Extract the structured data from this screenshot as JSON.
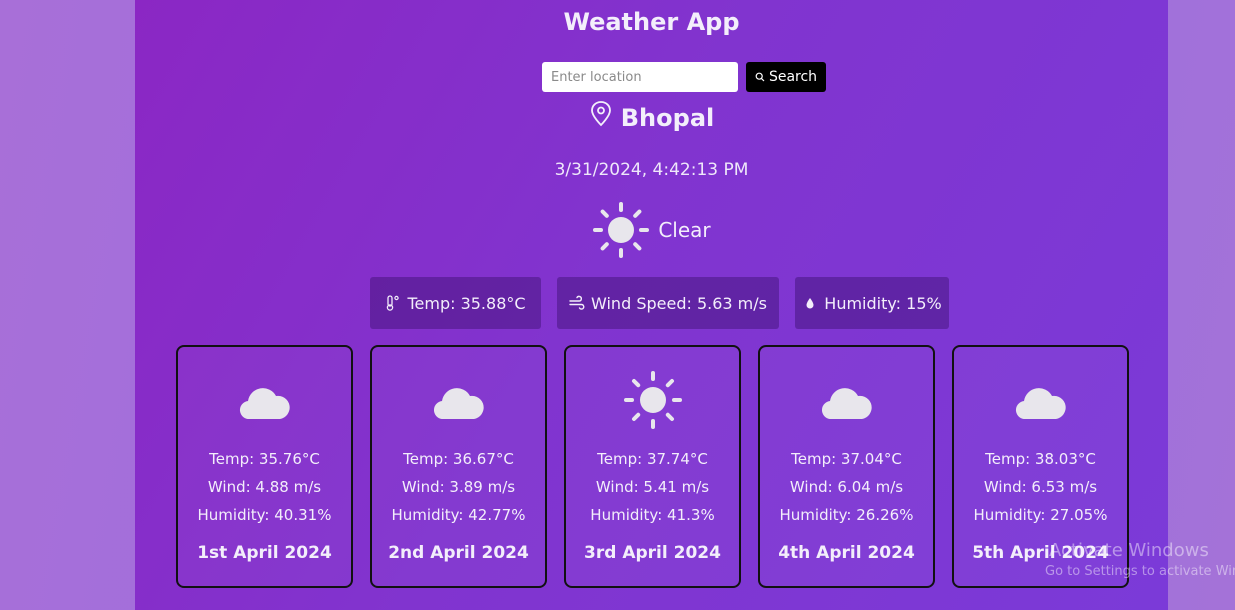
{
  "app": {
    "title": "Weather App"
  },
  "search": {
    "placeholder": "Enter location",
    "button_label": "Search"
  },
  "current": {
    "city": "Bhopal",
    "datetime": "3/31/2024, 4:42:13 PM",
    "condition": "Clear",
    "condition_icon": "sun-icon",
    "temp": "Temp: 35.88°C",
    "wind": "Wind Speed: 5.63 m/s",
    "humidity": "Humidity: 15%"
  },
  "forecast": [
    {
      "icon": "cloud-icon",
      "temp": "Temp: 35.76°C",
      "wind": "Wind: 4.88 m/s",
      "humidity": "Humidity: 40.31%",
      "date": "1st April 2024"
    },
    {
      "icon": "cloud-icon",
      "temp": "Temp: 36.67°C",
      "wind": "Wind: 3.89 m/s",
      "humidity": "Humidity: 42.77%",
      "date": "2nd April 2024"
    },
    {
      "icon": "sun-icon",
      "temp": "Temp: 37.74°C",
      "wind": "Wind: 5.41 m/s",
      "humidity": "Humidity: 41.3%",
      "date": "3rd April 2024"
    },
    {
      "icon": "cloud-icon",
      "temp": "Temp: 37.04°C",
      "wind": "Wind: 6.04 m/s",
      "humidity": "Humidity: 26.26%",
      "date": "4th April 2024"
    },
    {
      "icon": "cloud-icon",
      "temp": "Temp: 38.03°C",
      "wind": "Wind: 6.53 m/s",
      "humidity": "Humidity: 27.05%",
      "date": "5th April 2024"
    }
  ],
  "watermark": {
    "line1": "Activate Windows",
    "line2": "Go to Settings to activate Windows."
  },
  "colors": {
    "accent": "#8134cf",
    "text": "#f3eefb",
    "button": "#000000"
  }
}
